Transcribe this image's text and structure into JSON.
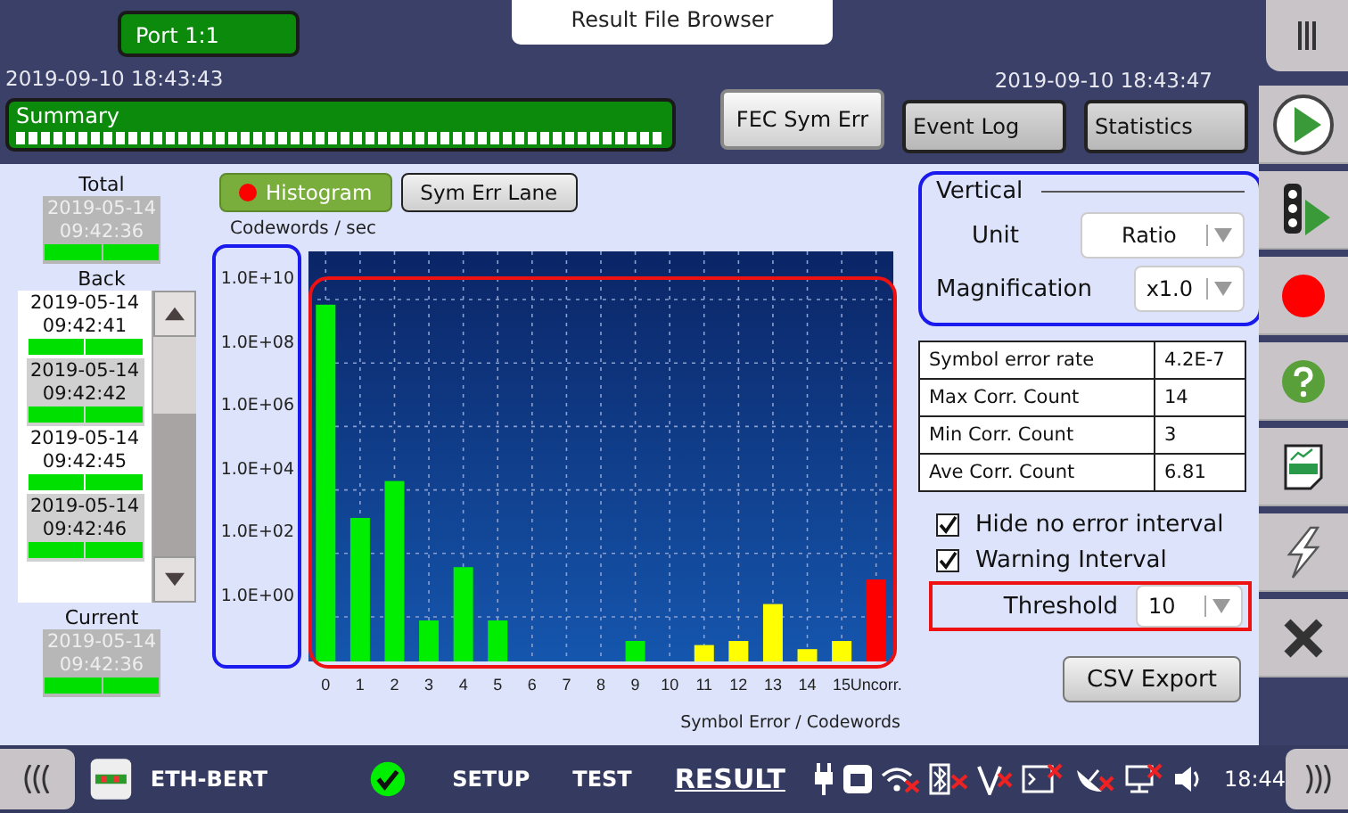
{
  "header": {
    "port_tab": "Port 1:1",
    "dialog_title": "Result File Browser",
    "start_time": "2019-09-10 18:43:43",
    "end_time": "2019-09-10 18:43:47",
    "summary_label": "Summary"
  },
  "result_tabs": [
    {
      "label": "FEC Sym Err",
      "selected": true
    },
    {
      "label": "Event Log",
      "selected": false
    },
    {
      "label": "Statistics",
      "selected": false
    }
  ],
  "history": {
    "total_label": "Total",
    "total": {
      "date": "2019-05-14",
      "time": "09:42:36"
    },
    "back_label": "Back",
    "back": [
      {
        "date": "2019-05-14",
        "time": "09:42:41"
      },
      {
        "date": "2019-05-14",
        "time": "09:42:42"
      },
      {
        "date": "2019-05-14",
        "time": "09:42:45"
      },
      {
        "date": "2019-05-14",
        "time": "09:42:46"
      }
    ],
    "current_label": "Current",
    "current": {
      "date": "2019-05-14",
      "time": "09:42:36"
    }
  },
  "view_tabs": [
    {
      "label": "Histogram",
      "selected": true
    },
    {
      "label": "Sym Err Lane",
      "selected": false
    }
  ],
  "chart": {
    "y_axis_label": "Codewords / sec",
    "y_axis_labels": [
      "1.0E+10",
      "1.0E+08",
      "1.0E+06",
      "1.0E+04",
      "1.0E+02",
      "1.0E+00"
    ],
    "x_labels": [
      "0",
      "1",
      "2",
      "3",
      "4",
      "5",
      "6",
      "7",
      "8",
      "9",
      "10",
      "11",
      "12",
      "13",
      "14",
      "15",
      "Uncorr."
    ],
    "x_axis_label": "Symbol Error / Codewords"
  },
  "vertical": {
    "title": "Vertical",
    "unit_label": "Unit",
    "unit_value": "Ratio",
    "magnification_label": "Magnification",
    "magnification_value": "x1.0"
  },
  "stats": [
    {
      "label": "Symbol error rate",
      "value": "4.2E-7"
    },
    {
      "label": "Max Corr.  Count",
      "value": "14"
    },
    {
      "label": "Min Corr.  Count",
      "value": "3"
    },
    {
      "label": "Ave Corr. Count",
      "value": "6.81"
    }
  ],
  "options": [
    {
      "label": "Hide no error interval",
      "checked": true
    },
    {
      "label": "Warning Interval",
      "checked": true
    }
  ],
  "threshold": {
    "label": "Threshold",
    "value": "10"
  },
  "csv_button": "CSV Export",
  "status_bar": {
    "app": "ETH-BERT",
    "nav": [
      {
        "label": "SETUP",
        "selected": false
      },
      {
        "label": "TEST",
        "selected": false
      },
      {
        "label": "RESULT",
        "selected": true
      }
    ],
    "time": "18:44"
  }
}
